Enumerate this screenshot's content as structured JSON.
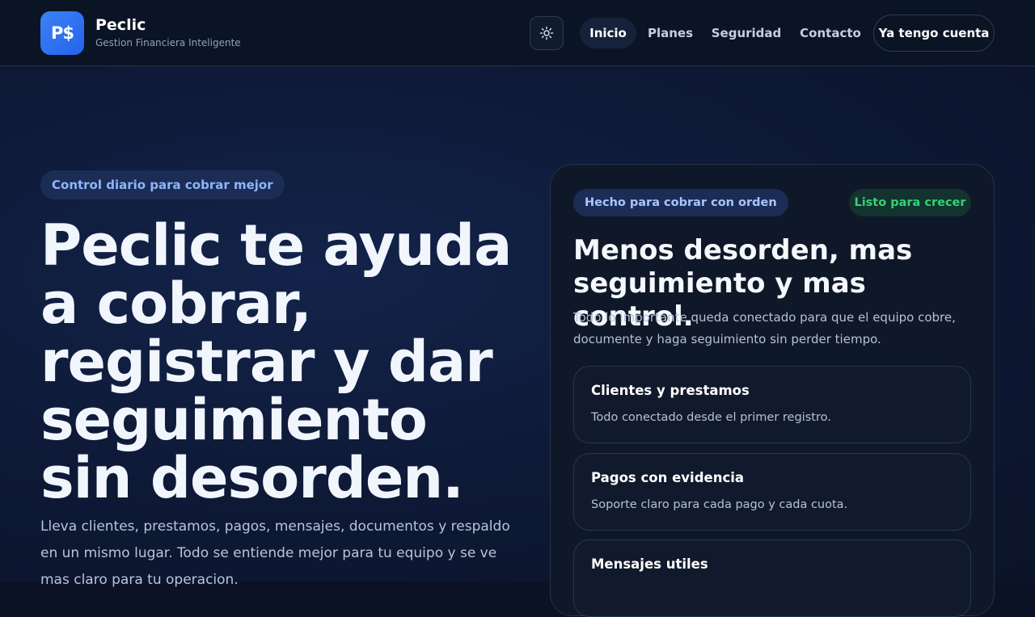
{
  "header": {
    "logo_text": "P$",
    "brand_name": "Peclic",
    "brand_tagline": "Gestion Financiera Inteligente",
    "theme_icon": "sun-icon",
    "nav": {
      "inicio": "Inicio",
      "planes": "Planes",
      "seguridad": "Seguridad",
      "contacto": "Contacto",
      "account": "Ya tengo cuenta"
    }
  },
  "hero": {
    "badge": "Control diario para cobrar mejor",
    "title": "Peclic te ayuda a cobrar, registrar y dar seguimiento sin desorden.",
    "description": "Lleva clientes, prestamos, pagos, mensajes, documentos y respaldo en un mismo lugar. Todo se entiende mejor para tu equipo y se ve mas claro para tu operacion."
  },
  "card": {
    "badge_left": "Hecho para cobrar con orden",
    "badge_right": "Listo para crecer",
    "title": "Menos desorden, mas seguimiento y mas control.",
    "description": "Todo lo importante queda conectado para que el equipo cobre, documente y haga seguimiento sin perder tiempo.",
    "features": [
      {
        "title": "Clientes y prestamos",
        "text": "Todo conectado desde el primer registro."
      },
      {
        "title": "Pagos con evidencia",
        "text": "Soporte claro para cada pago y cada cuota."
      },
      {
        "title": "Mensajes utiles",
        "text": ""
      }
    ]
  },
  "colors": {
    "accent": "#2563eb",
    "badge_blue_text": "#8fb4ff",
    "badge_green_text": "#34d07a",
    "background": "#0b1224"
  }
}
